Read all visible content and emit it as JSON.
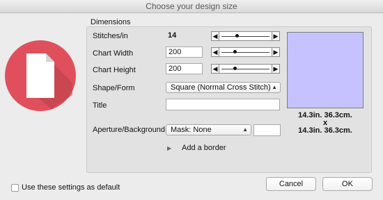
{
  "window": {
    "title": "Choose your design size"
  },
  "app_icon": {
    "name": "document-icon",
    "circle_color": "#e0505c",
    "shadow_color": "#b8404a"
  },
  "dimensions": {
    "group_label": "Dimensions",
    "stitches": {
      "label": "Stitches/in",
      "value": "14",
      "slider_level": 0.33
    },
    "chart_width": {
      "label": "Chart Width",
      "value": "200",
      "slider_level": 0.28
    },
    "chart_height": {
      "label": "Chart Height",
      "value": "200",
      "slider_level": 0.28
    },
    "shape_form": {
      "label": "Shape/Form",
      "selected": "Square (Normal Cross Stitch)"
    },
    "title": {
      "label": "Title",
      "value": ""
    },
    "aperture": {
      "label": "Aperture/Background",
      "selected": "Mask: None",
      "extra_value": ""
    },
    "border": {
      "label": "Add a border",
      "expanded": false
    }
  },
  "preview": {
    "color": "#c5c2ff",
    "size_line1": "14.3in. 36.3cm.",
    "separator": "x",
    "size_line2": "14.3in. 36.3cm."
  },
  "footer": {
    "default_checkbox_label": "Use these settings as default",
    "default_checked": false,
    "cancel_label": "Cancel",
    "ok_label": "OK"
  }
}
